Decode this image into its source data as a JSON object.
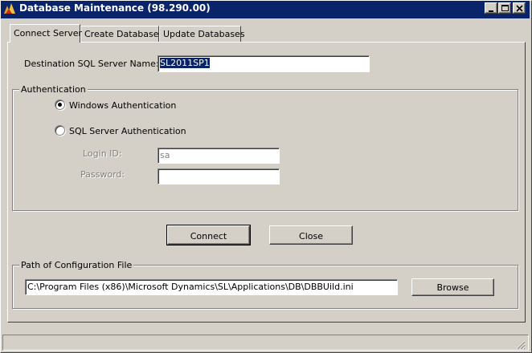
{
  "window": {
    "title": "Database Maintenance (98.290.00)"
  },
  "tabs": [
    {
      "label": "Connect Server",
      "active": true
    },
    {
      "label": "Create Databases",
      "active": false
    },
    {
      "label": "Update Databases",
      "active": false
    }
  ],
  "connect": {
    "server_label": "Destination SQL Server Name:",
    "server_value": "SL2011SP1",
    "auth": {
      "legend": "Authentication",
      "windows_label": "Windows Authentication",
      "windows_selected": true,
      "sql_label": "SQL Server Authentication",
      "sql_selected": false,
      "login_label": "Login ID:",
      "login_value": "sa",
      "password_label": "Password:",
      "password_value": ""
    },
    "connect_button": "Connect",
    "close_button": "Close"
  },
  "config": {
    "legend": "Path of Configuration File",
    "path": "C:\\Program Files (x86)\\Microsoft Dynamics\\SL\\Applications\\DB\\DBBUild.ini",
    "browse_button": "Browse"
  },
  "icons": {
    "app": "database-maintenance-icon",
    "minimize": "minimize-icon",
    "maximize": "maximize-icon",
    "close": "close-icon",
    "grip": "resize-grip-icon"
  }
}
